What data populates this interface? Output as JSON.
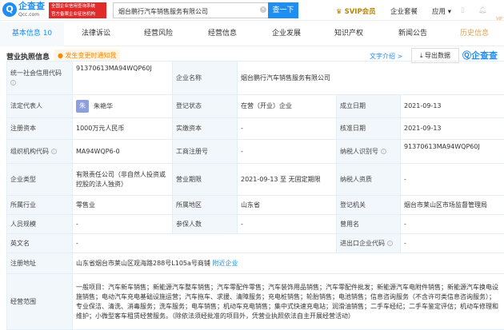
{
  "header": {
    "logo_text": "企查查",
    "logo_sub": "Qcc.com",
    "badge_line1": "全国企业信用查询系统",
    "badge_line2": "官方备案企业征信机构",
    "search_value": "烟台鹏行汽车销售服务有限公司",
    "search_button": "查一下",
    "svip": "SVIP会员",
    "enterprise": "企业套餐",
    "apps": "应用"
  },
  "tabs": [
    {
      "label": "基本信息 10"
    },
    {
      "label": "法律诉讼"
    },
    {
      "label": "经营风险"
    },
    {
      "label": "经营信息"
    },
    {
      "label": "企业发展"
    },
    {
      "label": "知识产权"
    },
    {
      "label": "新闻公告"
    },
    {
      "label": "历史信息",
      "badge": "VIP"
    }
  ],
  "section": {
    "title": "营业执照信息",
    "notify": "发生变更时通知我",
    "intro": "文字介绍 >",
    "export": "导出数据",
    "watermark": "企查查"
  },
  "fields": {
    "credit_code_label": "统一社会信用代码",
    "credit_code": "91370613MA94WQP60J",
    "name_label": "企业名称",
    "name": "烟台鹏行汽车销售服务有限公司",
    "legal_label": "法定代表人",
    "legal_avatar": "朱",
    "legal": "朱艳华",
    "status_label": "登记状态",
    "status": "在营（开业）企业",
    "found_label": "成立日期",
    "found": "2021-09-13",
    "capital_label": "注册资本",
    "capital": "1000万元人民币",
    "paid_label": "实缴资本",
    "paid": "-",
    "approve_label": "核准日期",
    "approve": "2021-09-13",
    "org_label": "组织机构代码",
    "org": "MA94WQP6-0",
    "biz_reg_label": "工商注册号",
    "biz_reg": "-",
    "tax_label": "纳税人识别号",
    "tax": "91370613MA94WQP60J",
    "type_label": "企业类型",
    "type": "有限责任公司（非自然人投资或控股的法人独资）",
    "term_label": "营业期限",
    "term": "2021-09-13 至 无固定期限",
    "taxq_label": "纳税人资质",
    "taxq": "-",
    "industry_label": "所属行业",
    "industry": "零售业",
    "region_label": "所属地区",
    "region": "山东省",
    "authority_label": "登记机关",
    "authority": "烟台市莱山区市场监督管理局",
    "staff_label": "人员规模",
    "staff": "-",
    "insured_label": "参保人数",
    "insured": "-",
    "former_label": "曾用名",
    "former": "-",
    "en_label": "英文名",
    "en": "-",
    "ie_label": "进出口企业代码",
    "ie": "-",
    "addr_label": "注册地址",
    "addr": "山东省烟台市莱山区观海路288号L105a号商铺",
    "nearby": "附近企业",
    "scope_label": "经营范围",
    "scope": "一般项目：汽车新车销售；新能源汽车整车销售；汽车零配件零售；汽车装饰用品销售；汽车零配件批发；新能源汽车电附件销售；新能源汽车换电设施销售；电动汽车充电基础设施运营；汽车拖车、求援、清障服务；充电桩销售；轮胎销售；电池销售；信息咨询服务（不含许可类信息咨询服务）；专业保洁、清洗、消毒服务；洗车服务；电车销售；机动车充电销售；集中式快速充电站；润滑油销售；二手车经纪；二手车鉴定评估；机动车修理和维护；小微型客车租赁经营服务。（除依法须经批准的项目外，凭营业执照依法自主开展经营活动）"
  }
}
